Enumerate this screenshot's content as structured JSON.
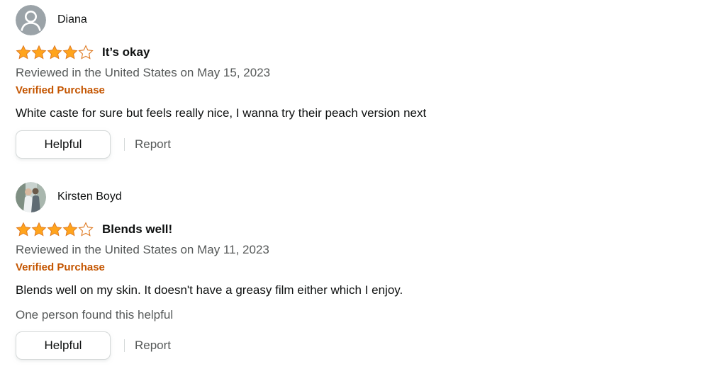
{
  "colors": {
    "star_fill": "#ffa41c",
    "star_outline": "#de7921",
    "verified": "#c45500",
    "secondary_text": "#565959"
  },
  "reviews": [
    {
      "profile_name": "Diana",
      "avatar": "default-avatar-icon",
      "rating": 4,
      "rating_max": 5,
      "title": "It’s okay",
      "date_line": "Reviewed in the United States on May 15, 2023",
      "verified": "Verified Purchase",
      "body": "White caste for sure but feels really nice, I wanna try their peach version next",
      "helpful_count": "",
      "helpful_label": "Helpful",
      "report_label": "Report"
    },
    {
      "profile_name": "Kirsten Boyd",
      "avatar": "photo-avatar",
      "rating": 4,
      "rating_max": 5,
      "title": "Blends well!",
      "date_line": "Reviewed in the United States on May 11, 2023",
      "verified": "Verified Purchase",
      "body": "Blends well on my skin. It doesn't have a greasy film either which I enjoy.",
      "helpful_count": "One person found this helpful",
      "helpful_label": "Helpful",
      "report_label": "Report"
    }
  ]
}
